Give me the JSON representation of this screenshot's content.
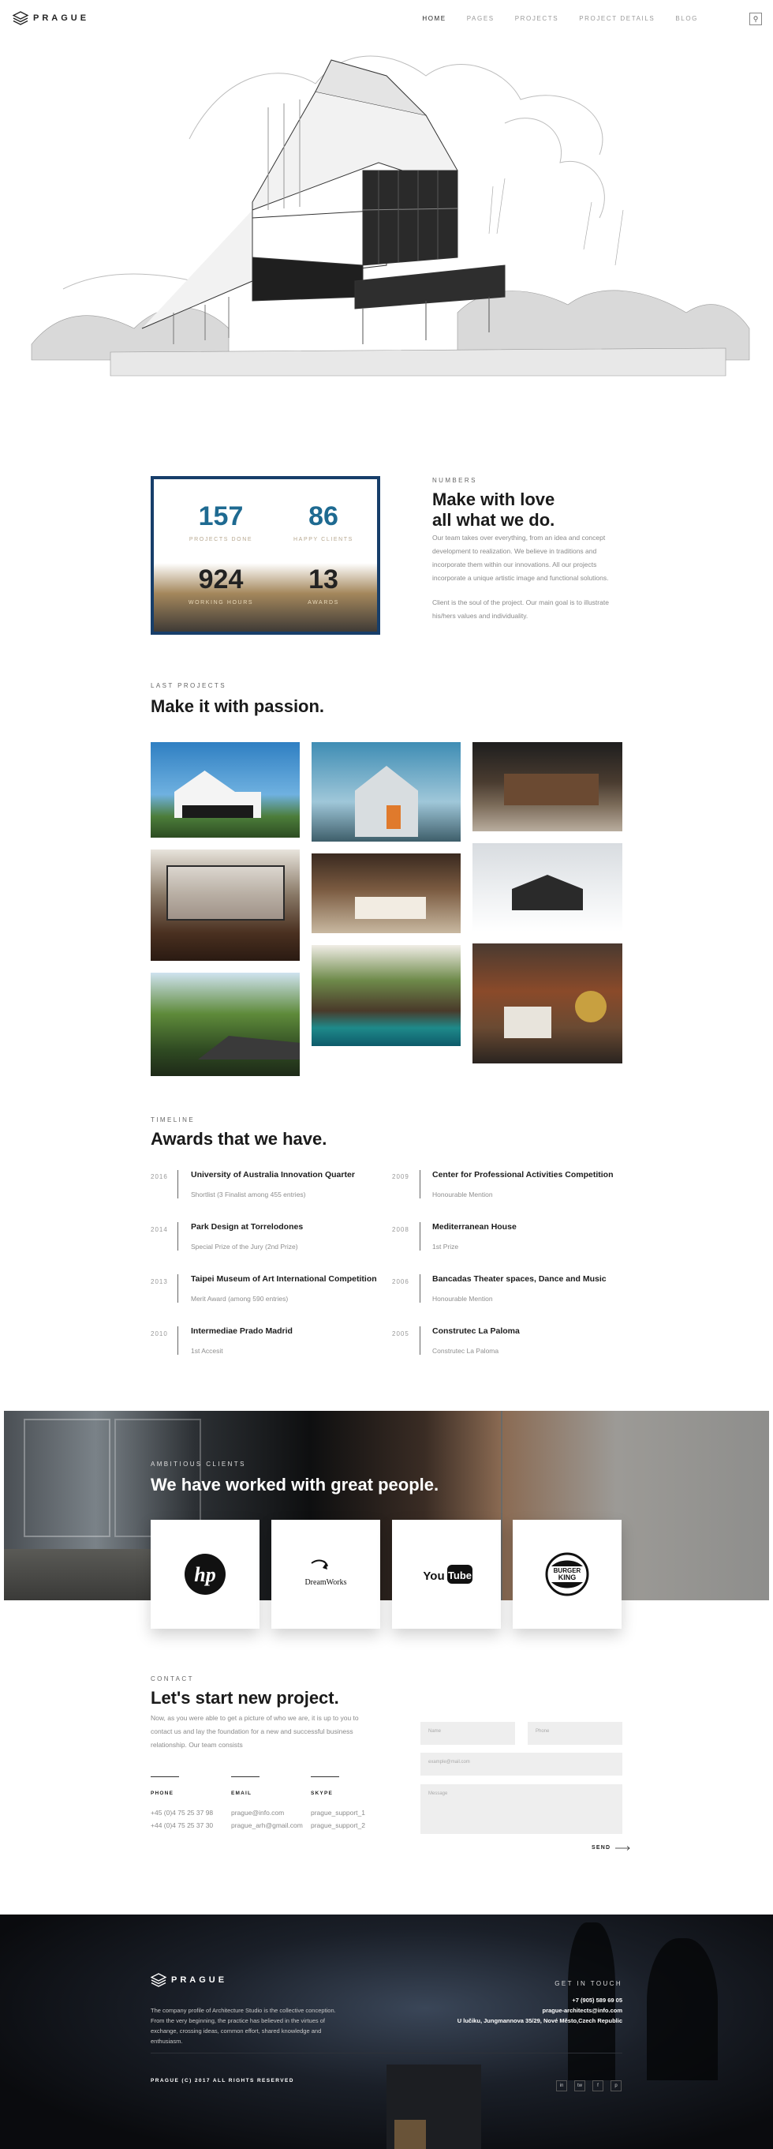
{
  "header": {
    "brand": "PRAGUE",
    "nav": [
      "HOME",
      "PAGES",
      "PROJECTS",
      "PROJECT DETAILS",
      "BLOG"
    ],
    "active_nav": "HOME"
  },
  "numbers": {
    "eyebrow": "NUMBERS",
    "title_line1": "Make with love",
    "title_line2": "all what we do.",
    "paragraph1": "Our team takes over everything, from an idea and concept development to realization. We believe in traditions and incorporate them within our innovations. All our projects incorporate a unique artistic image and functional solutions.",
    "paragraph2": "Client is the soul of the project. Our main goal is to illustrate his/hers values and individuality.",
    "stats": [
      {
        "value": "157",
        "label": "PROJECTS DONE"
      },
      {
        "value": "86",
        "label": "HAPPY CLIENTS"
      },
      {
        "value": "924",
        "label": "WORKING HOURS"
      },
      {
        "value": "13",
        "label": "AWARDS"
      }
    ]
  },
  "projects": {
    "eyebrow": "LAST PROJECTS",
    "title": "Make it with passion."
  },
  "awards": {
    "eyebrow": "TIMELINE",
    "title": "Awards that we have.",
    "left": [
      {
        "year": "2016",
        "title": "University of Australia Innovation Quarter",
        "subtitle": "Shortlist (3 Finalist among 455 entries)"
      },
      {
        "year": "2014",
        "title": "Park Design at Torrelodones",
        "subtitle": "Special Prize of the Jury (2nd Prize)"
      },
      {
        "year": "2013",
        "title": "Taipei Museum of Art International Competition",
        "subtitle": "Merit Award (among 590 entries)"
      },
      {
        "year": "2010",
        "title": "Intermediae Prado Madrid",
        "subtitle": "1st Accesit"
      }
    ],
    "right": [
      {
        "year": "2009",
        "title": "Center for Professional Activities Competition",
        "subtitle": "Honourable Mention"
      },
      {
        "year": "2008",
        "title": "Mediterranean House",
        "subtitle": "1st Prize"
      },
      {
        "year": "2006",
        "title": "Bancadas Theater spaces, Dance and Music",
        "subtitle": "Honourable Mention"
      },
      {
        "year": "2005",
        "title": "Construtec La Paloma",
        "subtitle": "Construtec La Paloma"
      }
    ]
  },
  "partners": {
    "eyebrow": "AMBITIOUS CLIENTS",
    "title": "We have worked with great people.",
    "logos": [
      "hp",
      "DreamWorks",
      "YouTube",
      "BURGER KING"
    ]
  },
  "contact": {
    "eyebrow": "CONTACT",
    "title": "Let's start new project.",
    "text": "Now, as you were able to get a picture of who we are, it is up to you to contact us and lay the foundation for a new and successful business relationship. Our team consists",
    "phone_label": "PHONE",
    "phones": [
      "+45 (0)4 75 25 37 98",
      "+44 (0)4 75 25 37 30"
    ],
    "email_label": "EMAIL",
    "emails": [
      "prague@info.com",
      "prague_arh@gmail.com"
    ],
    "skype_label": "SKYPE",
    "skypes": [
      "prague_support_1",
      "prague_support_2"
    ],
    "form": {
      "name_placeholder": "Name",
      "phone_placeholder": "Phone",
      "email_placeholder": "example@mail.com",
      "message_placeholder": "Message",
      "send_label": "SEND"
    }
  },
  "footer": {
    "brand": "PRAGUE",
    "about": "The company profile of Architecture Studio is the collective conception. From the very beginning, the practice has believed in the virtues of exchange, crossing ideas, common effort, shared knowledge and enthusiasm.",
    "get_in_touch": "GET IN TOUCH",
    "phone": "+7 (905) 589 69 05",
    "email": "prague-architects@info.com",
    "address": "U lučiku, Jungmannova 35/29, Nové Město,Czech Republic",
    "copyright": "PRAGUE (C) 2017 ALL RIGHTS RESERVED",
    "social": [
      "in",
      "tw",
      "f",
      "p"
    ]
  }
}
